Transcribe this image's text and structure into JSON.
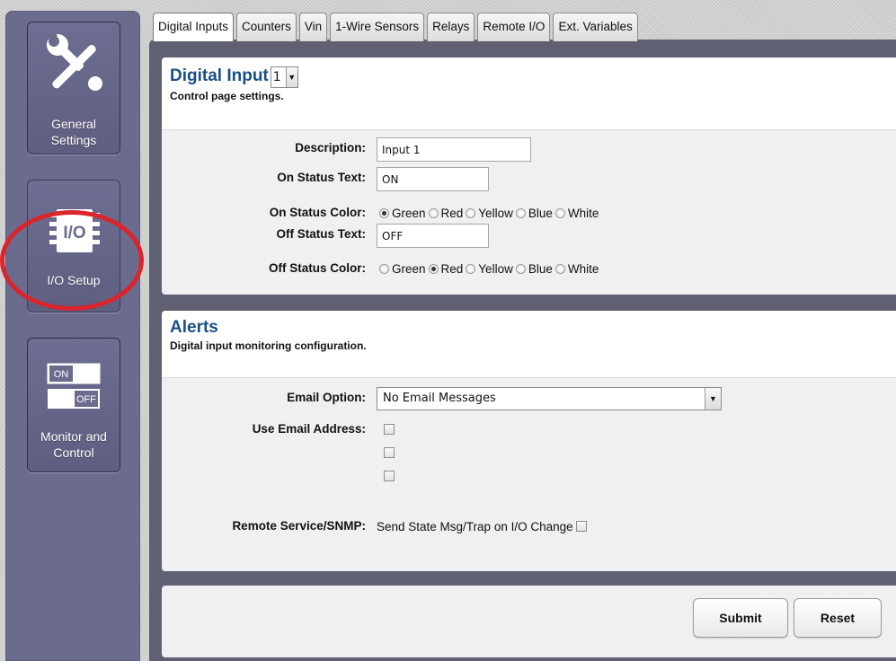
{
  "sidebar": {
    "general_settings": {
      "label_line1": "General",
      "label_line2": "Settings",
      "icon": "tools-icon"
    },
    "io_setup": {
      "label": "I/O Setup",
      "icon_text": "I/O",
      "icon": "chip-icon"
    },
    "monitor_control": {
      "label_line1": "Monitor and",
      "label_line2": "Control",
      "icon": "on-off-switch-icon",
      "switch_on": "ON",
      "switch_off": "OFF"
    }
  },
  "tabs": [
    {
      "label": "Digital Inputs",
      "active": true
    },
    {
      "label": "Counters"
    },
    {
      "label": "Vin"
    },
    {
      "label": "1-Wire Sensors"
    },
    {
      "label": "Relays"
    },
    {
      "label": "Remote I/O"
    },
    {
      "label": "Ext. Variables"
    }
  ],
  "digital_input": {
    "title": "Digital Input",
    "selected_input": "1",
    "subtitle": "Control page settings.",
    "description_label": "Description:",
    "description_value": "Input 1",
    "on_status_text_label": "On Status Text:",
    "on_status_text_value": "ON",
    "on_status_color_label": "On Status Color:",
    "off_status_text_label": "Off Status Text:",
    "off_status_text_value": "OFF",
    "off_status_color_label": "Off Status Color:",
    "color_options": [
      "Green",
      "Red",
      "Yellow",
      "Blue",
      "White"
    ],
    "on_status_color_selected": "Green",
    "off_status_color_selected": "Red"
  },
  "alerts": {
    "title": "Alerts",
    "subtitle": "Digital input monitoring configuration.",
    "email_option_label": "Email Option:",
    "email_option_value": "No Email Messages",
    "use_email_label": "Use Email Address:",
    "remote_service_label": "Remote Service/SNMP:",
    "remote_service_text": "Send State Msg/Trap on I/O Change"
  },
  "actions": {
    "submit": "Submit",
    "reset": "Reset"
  },
  "colors": {
    "sidebar": "#6b6b8e",
    "title_blue": "#1a4f86",
    "highlight_ring": "#d9252b",
    "panel": "#5f6072"
  }
}
